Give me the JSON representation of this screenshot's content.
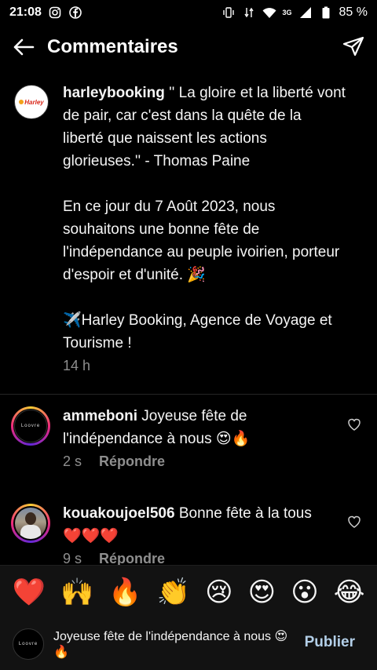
{
  "status_bar": {
    "time": "21:08",
    "left_icons": [
      "instagram-icon",
      "facebook-icon"
    ],
    "network": "3G",
    "battery": "85 %"
  },
  "header": {
    "title": "Commentaires"
  },
  "caption": {
    "username": "harleybooking",
    "brand_logo_text": "Harley",
    "text": " '' La gloire et la liberté vont de pair, car c'est dans la quête de la liberté que naissent les actions glorieuses.'' - Thomas Paine\n\nEn ce jour du 7 Août 2023, nous souhaitons une bonne fête de l'indépendance au peuple ivoirien, porteur d'espoir et d'unité. 🎉\n\n✈️Harley Booking, Agence de Voyage et Tourisme !",
    "time": "14 h"
  },
  "comments": [
    {
      "username": "ammeboni",
      "text": " Joyeuse fête de l'indépendance à nous 😍🔥",
      "time": "2 s",
      "reply_label": "Répondre",
      "avatar_mark": "Loovre"
    },
    {
      "username": "kouakoujoel506",
      "text": " Bonne fête à la tous❤️❤️❤️",
      "time": "9 s",
      "reply_label": "Répondre"
    }
  ],
  "emoji_bar": [
    "❤️",
    "🙌",
    "🔥",
    "👏",
    "😢",
    "😍",
    "😮",
    "😂"
  ],
  "input": {
    "value": "Joyeuse fête de l'indépendance à nous 😍🔥",
    "publish_label": "Publier",
    "avatar_mark": "Loovre"
  },
  "colors": {
    "background": "#000000",
    "secondary_text": "#8e8e8e",
    "publish": "#b3cfe8"
  }
}
